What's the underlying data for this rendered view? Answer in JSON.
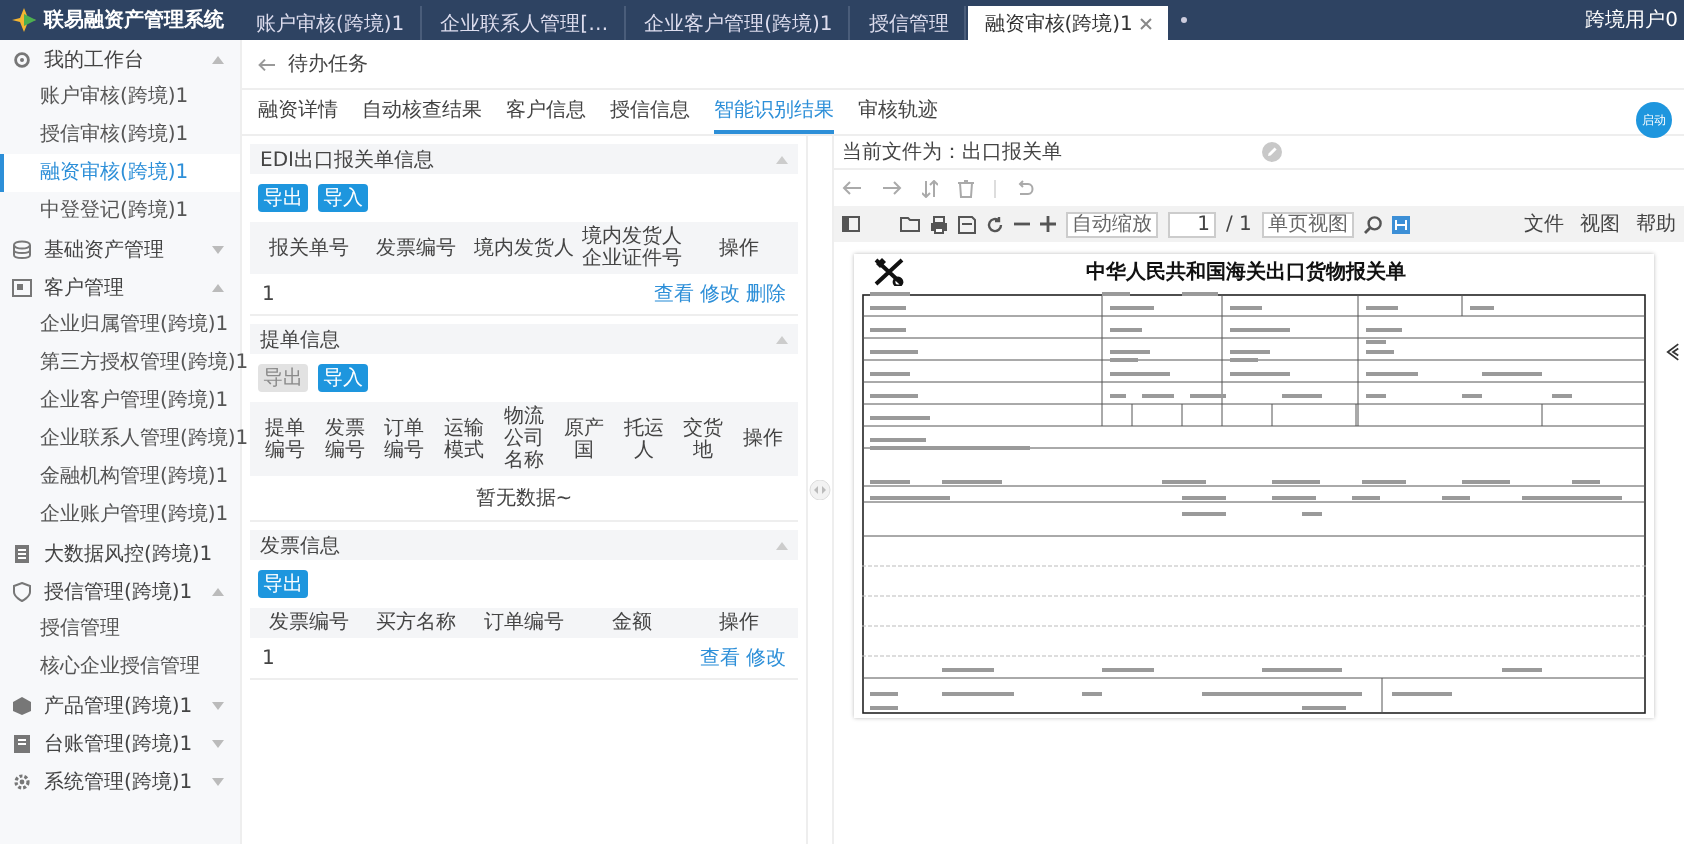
{
  "app": {
    "title": "联易融资产管理系统",
    "user": "跨境用户0"
  },
  "tabs": [
    {
      "label": "账户审核(跨境)1",
      "selected": false
    },
    {
      "label": "企业联系人管理[…",
      "selected": false
    },
    {
      "label": "企业客户管理(跨境)1",
      "selected": false
    },
    {
      "label": "授信管理",
      "selected": false
    },
    {
      "label": "融资审核(跨境)1",
      "selected": true
    }
  ],
  "sidebar": {
    "items": [
      {
        "label": "我的工作台",
        "kind": "group",
        "expanded": true,
        "children": [
          {
            "label": "账户审核(跨境)1",
            "selected": false
          },
          {
            "label": "授信审核(跨境)1",
            "selected": false
          },
          {
            "label": "融资审核(跨境)1",
            "selected": true
          },
          {
            "label": "中登登记(跨境)1",
            "selected": false
          }
        ]
      },
      {
        "label": "基础资产管理",
        "kind": "group",
        "expanded": false
      },
      {
        "label": "客户管理",
        "kind": "group",
        "expanded": true,
        "children": [
          {
            "label": "企业归属管理(跨境)1",
            "selected": false
          },
          {
            "label": "第三方授权管理(跨境)1",
            "selected": false
          },
          {
            "label": "企业客户管理(跨境)1",
            "selected": false
          },
          {
            "label": "企业联系人管理(跨境)1",
            "selected": false
          },
          {
            "label": "金融机构管理(跨境)1",
            "selected": false
          },
          {
            "label": "企业账户管理(跨境)1",
            "selected": false
          }
        ]
      },
      {
        "label": "大数据风控(跨境)1",
        "kind": "link"
      },
      {
        "label": "授信管理(跨境)1",
        "kind": "group",
        "expanded": true,
        "children": [
          {
            "label": "授信管理",
            "selected": false
          },
          {
            "label": "核心企业授信管理",
            "selected": false
          }
        ]
      },
      {
        "label": "产品管理(跨境)1",
        "kind": "group",
        "expanded": false
      },
      {
        "label": "台账管理(跨境)1",
        "kind": "group",
        "expanded": false
      },
      {
        "label": "系统管理(跨境)1",
        "kind": "group",
        "expanded": false
      }
    ]
  },
  "back": "待办任务",
  "subtabs": [
    {
      "label": "融资详情",
      "selected": false
    },
    {
      "label": "自动核查结果",
      "selected": false
    },
    {
      "label": "客户信息",
      "selected": false
    },
    {
      "label": "授信信息",
      "selected": false
    },
    {
      "label": "智能识别结果",
      "selected": true
    },
    {
      "label": "审核轨迹",
      "selected": false
    }
  ],
  "fab": "启动",
  "sections": [
    {
      "title": "EDI出口报关单信息",
      "buttons": [
        {
          "label": "导出",
          "disabled": false
        },
        {
          "label": "导入",
          "disabled": false
        }
      ],
      "columns": [
        "报关单号",
        "发票编号",
        "境内发货人",
        "境内发货人企业证件号",
        "操作"
      ],
      "rows": [
        {
          "index": "1",
          "actions": [
            "查看",
            "修改",
            "删除"
          ]
        }
      ]
    },
    {
      "title": "提单信息",
      "buttons": [
        {
          "label": "导出",
          "disabled": true
        },
        {
          "label": "导入",
          "disabled": false
        }
      ],
      "columns": [
        "提单编号",
        "发票编号",
        "订单编号",
        "运输模式",
        "物流公司名称",
        "原产国",
        "托运人",
        "交货地",
        "操作"
      ],
      "empty": "暂无数据~"
    },
    {
      "title": "发票信息",
      "buttons": [
        {
          "label": "导出",
          "disabled": false
        }
      ],
      "columns": [
        "发票编号",
        "买方名称",
        "订单编号",
        "金额",
        "操作"
      ],
      "rows": [
        {
          "index": "1",
          "actions": [
            "查看",
            "修改"
          ]
        }
      ]
    }
  ],
  "viewer": {
    "current_file": "当前文件为：出口报关单",
    "zoom": "自动缩放",
    "page": "1",
    "page_total": "/ 1",
    "view_mode": "单页视图",
    "menus": [
      "文件",
      "视图",
      "帮助"
    ],
    "document": {
      "title": "中华人民共和国海关出口货物报关单"
    }
  }
}
